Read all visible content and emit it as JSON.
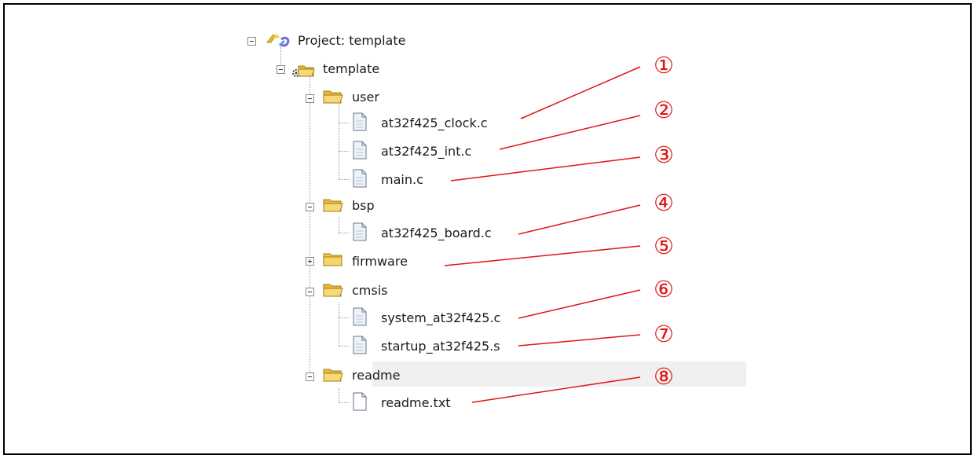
{
  "tree": {
    "project": {
      "label": "Project: template",
      "icon": "project-icon"
    },
    "target": {
      "label": "template",
      "icon": "target-folder-icon"
    },
    "groups": [
      {
        "label": "user",
        "state": "expanded",
        "files": [
          {
            "label": "at32f425_clock.c",
            "callout": "①"
          },
          {
            "label": "at32f425_int.c",
            "callout": "②"
          },
          {
            "label": "main.c",
            "callout": "③"
          }
        ]
      },
      {
        "label": "bsp",
        "state": "expanded",
        "files": [
          {
            "label": "at32f425_board.c",
            "callout": "④"
          }
        ]
      },
      {
        "label": "firmware",
        "state": "collapsed",
        "callout": "⑤",
        "files": []
      },
      {
        "label": "cmsis",
        "state": "expanded",
        "files": [
          {
            "label": "system_at32f425.c",
            "callout": "⑥"
          },
          {
            "label": "startup_at32f425.s",
            "callout": "⑦"
          }
        ]
      },
      {
        "label": "readme",
        "state": "expanded",
        "selected": true,
        "files": [
          {
            "label": "readme.txt",
            "callout": "⑧"
          }
        ]
      }
    ]
  },
  "colors": {
    "callout": "#e01515",
    "folder": "#f2c94c",
    "highlight": "#f0f0f0"
  }
}
